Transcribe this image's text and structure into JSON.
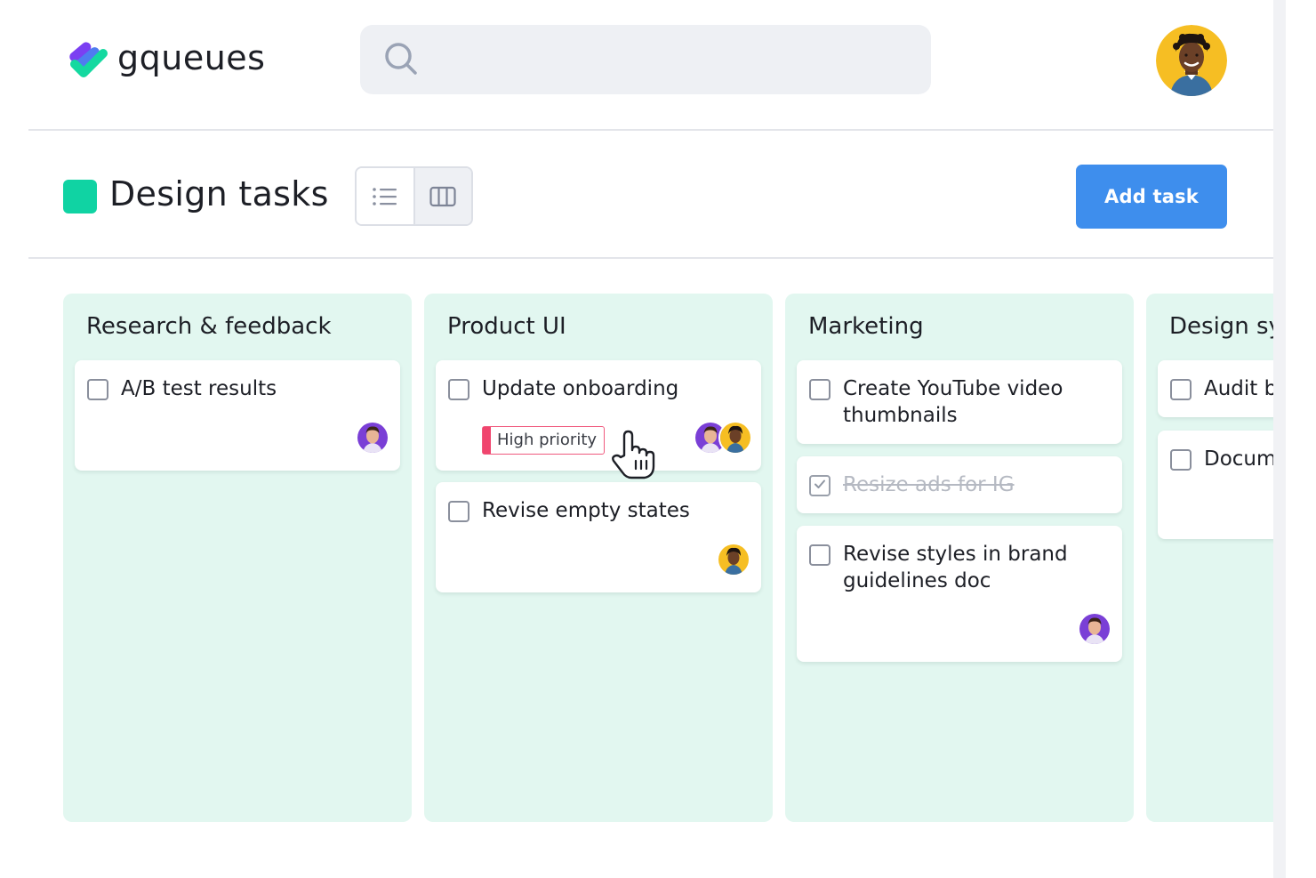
{
  "app": {
    "name": "gqueues"
  },
  "search": {
    "placeholder": ""
  },
  "toolbar": {
    "project_title": "Design tasks",
    "add_task_label": "Add task",
    "active_view": "board"
  },
  "colors": {
    "accent": "#3e8eed",
    "project": "#10d3a3",
    "column_bg": "#e2f7f0",
    "priority": "#f0456e"
  },
  "columns": [
    {
      "title": "Research & feedback",
      "tasks": [
        {
          "title": "A/B test results",
          "done": false,
          "assignees": [
            "avatar-purple"
          ]
        }
      ]
    },
    {
      "title": "Product UI",
      "tasks": [
        {
          "title": "Update onboarding",
          "done": false,
          "tag": "High priority",
          "assignees": [
            "avatar-purple",
            "avatar-yellow"
          ]
        },
        {
          "title": "Revise empty states",
          "done": false,
          "assignees": [
            "avatar-yellow"
          ]
        }
      ]
    },
    {
      "title": "Marketing",
      "tasks": [
        {
          "title": "Create YouTube video thumbnails",
          "done": false,
          "assignees": []
        },
        {
          "title": "Resize ads for IG",
          "done": true,
          "assignees": []
        },
        {
          "title": "Revise styles in brand guidelines doc",
          "done": false,
          "assignees": [
            "avatar-purple"
          ]
        }
      ]
    },
    {
      "title": "Design sy",
      "tasks": [
        {
          "title": "Audit b",
          "done": false,
          "assignees": []
        },
        {
          "title": "Docum",
          "done": false,
          "assignees": []
        }
      ]
    }
  ]
}
